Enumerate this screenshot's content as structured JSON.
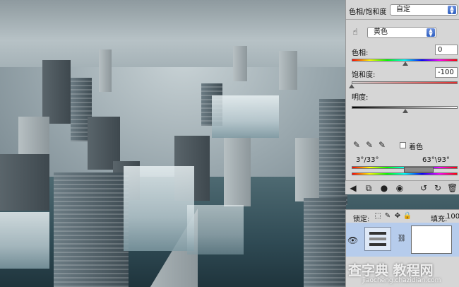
{
  "adjustments": {
    "preset_label": "色相/饱和度",
    "preset_value": "自定",
    "channel_value": "黄色",
    "hue_label": "色相:",
    "hue_value": "0",
    "saturation_label": "饱和度:",
    "saturation_value": "-100",
    "lightness_label": "明度:",
    "colorize_label": "着色",
    "range_left": "3°/33°",
    "range_right": "63°\\93°"
  },
  "layers": {
    "lock_label": "锁定:",
    "fill_label": "填充:",
    "fill_value": "100"
  },
  "watermark": {
    "main": "查字典 教程网",
    "url": "jiaocheng.chazidian.com"
  },
  "icons": [
    "hand-adjust-icon",
    "eyedropper-icon",
    "eyedropper-plus-icon",
    "eyedropper-minus-icon",
    "eye-icon",
    "chain-link-icon",
    "lock-icon"
  ]
}
